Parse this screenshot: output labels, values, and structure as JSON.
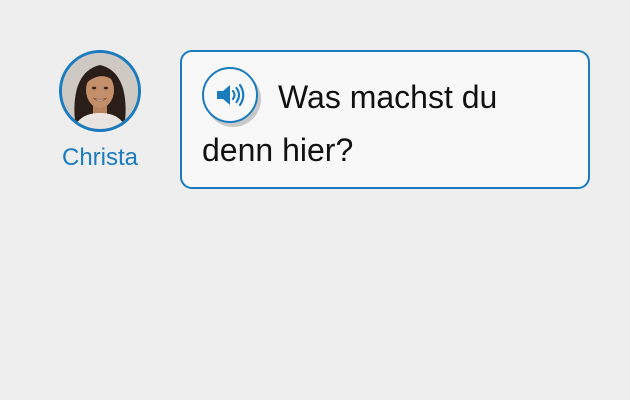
{
  "speaker": {
    "name": "Christa",
    "avatar_icon": "woman-portrait"
  },
  "message": {
    "line_1": "Was machst du",
    "line_2": "denn hier?",
    "audio_icon": "speaker-volume-icon"
  },
  "colors": {
    "accent": "#1a7bbf",
    "background": "#eeeeee",
    "bubble_background": "#f8f8f8",
    "text": "#111111"
  }
}
